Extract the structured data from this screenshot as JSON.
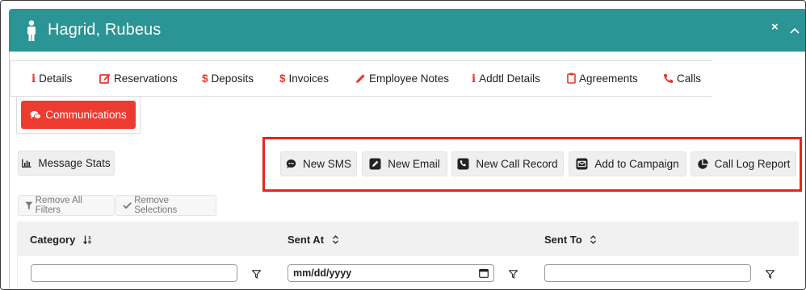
{
  "header": {
    "title": "Hagrid, Rubeus",
    "close_symbol": "×"
  },
  "tabs": [
    {
      "label": "Details",
      "icon": "info-icon"
    },
    {
      "label": "Reservations",
      "icon": "edit-icon"
    },
    {
      "label": "Deposits",
      "icon": "dollar-icon"
    },
    {
      "label": "Invoices",
      "icon": "dollar-icon"
    },
    {
      "label": "Employee Notes",
      "icon": "pencil-icon"
    },
    {
      "label": "Addtl Details",
      "icon": "info-icon"
    },
    {
      "label": "Agreements",
      "icon": "clipboard-icon"
    },
    {
      "label": "Calls",
      "icon": "phone-icon"
    }
  ],
  "active_tab": {
    "label": "Communications",
    "icon": "comments-icon"
  },
  "actions": {
    "message_stats": "Message Stats",
    "new_sms": "New SMS",
    "new_email": "New Email",
    "new_call_record": "New Call Record",
    "add_to_campaign": "Add to Campaign",
    "call_log_report": "Call Log Report"
  },
  "filters": {
    "remove_all_filters": "Remove All Filters",
    "remove_selections": "Remove Selections"
  },
  "table": {
    "columns": [
      "Category",
      "Sent At",
      "Sent To"
    ],
    "date_placeholder": "mm/dd/yyyy",
    "category_value": "",
    "sent_to_value": ""
  },
  "colors": {
    "header": "#2b9494",
    "accent": "#ee3b2f",
    "icon_red": "#e23a2e",
    "highlight": "#e8241a"
  }
}
